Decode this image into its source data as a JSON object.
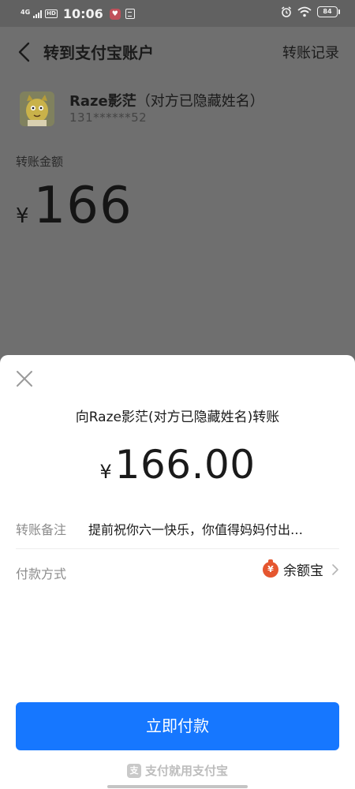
{
  "status_bar": {
    "network": "4G",
    "hd": "HD",
    "time": "10:06",
    "battery": "84"
  },
  "header": {
    "title": "转到支付宝账户",
    "history_label": "转账记录"
  },
  "recipient": {
    "name": "Raze影茫",
    "name_note": "（对方已隐藏姓名）",
    "account": "131******52"
  },
  "transfer": {
    "amount_label": "转账金额",
    "currency": "¥",
    "amount": "166"
  },
  "sheet": {
    "title": "向Raze影茫(对方已隐藏姓名)转账",
    "currency": "¥",
    "amount": "166.00",
    "remark_label": "转账备注",
    "remark_value": "提前祝你六一快乐，你值得妈妈付出…",
    "payment_label": "付款方式",
    "payment_method": "余额宝",
    "payment_icon_glyph": "¥",
    "pay_button_label": "立即付款",
    "footer_text": "支付就用支付宝"
  },
  "colors": {
    "accent": "#1677ff",
    "payment_icon": "#e5562f"
  },
  "icons": [
    "back-arrow-icon",
    "close-icon",
    "yuebao-icon",
    "chevron-right-icon",
    "alipay-logo-icon",
    "alarm-icon",
    "wifi-icon",
    "battery-icon",
    "signal-icon"
  ]
}
